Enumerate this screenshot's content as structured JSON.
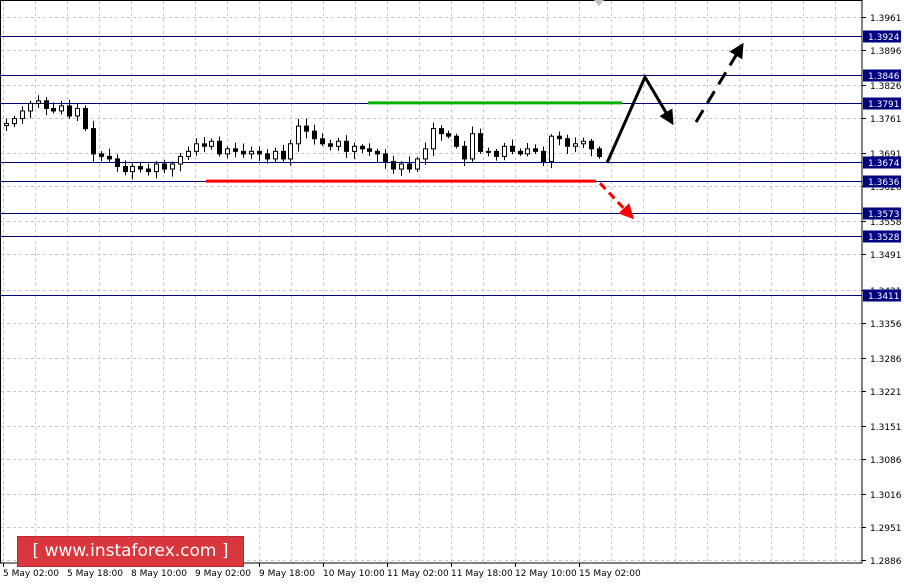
{
  "chart_data": {
    "type": "candlestick",
    "title": "",
    "y_range": [
      1.2886,
      1.3961
    ],
    "y_ticks": [
      "1.3961",
      "1.3896",
      "1.3826",
      "1.3761",
      "1.3691",
      "1.3626",
      "1.3558",
      "1.3491",
      "1.3421",
      "1.3356",
      "1.3286",
      "1.3221",
      "1.3151",
      "1.3086",
      "1.3016",
      "1.2951",
      "1.2886"
    ],
    "x_labels": [
      "5 May 02:00",
      "5 May 18:00",
      "8 May 10:00",
      "9 May 02:00",
      "9 May 18:00",
      "10 May 10:00",
      "11 May 02:00",
      "11 May 18:00",
      "12 May 10:00",
      "15 May 02:00"
    ],
    "levels": [
      {
        "label": "1.3924",
        "value": 1.3924
      },
      {
        "label": "1.3846",
        "value": 1.3846
      },
      {
        "label": "1.3791",
        "value": 1.3791
      },
      {
        "label": "1.3674",
        "value": 1.3674
      },
      {
        "label": "1.3636",
        "value": 1.3636
      },
      {
        "label": "1.3573",
        "value": 1.3573
      },
      {
        "label": "1.3528",
        "value": 1.3528
      },
      {
        "label": "1.3411",
        "value": 1.3411
      }
    ],
    "close_series": [
      1.375,
      1.376,
      1.3775,
      1.379,
      1.3795,
      1.378,
      1.3775,
      1.3785,
      1.3765,
      1.378,
      1.374,
      1.369,
      1.3685,
      1.368,
      1.3665,
      1.3655,
      1.3665,
      1.366,
      1.3655,
      1.367,
      1.366,
      1.367,
      1.3685,
      1.3695,
      1.371,
      1.3705,
      1.3715,
      1.369,
      1.37,
      1.3695,
      1.369,
      1.3695,
      1.369,
      1.368,
      1.3695,
      1.368,
      1.371,
      1.3745,
      1.3735,
      1.372,
      1.371,
      1.3705,
      1.3715,
      1.3695,
      1.3705,
      1.37,
      1.3695,
      1.369,
      1.3675,
      1.366,
      1.367,
      1.366,
      1.368,
      1.37,
      1.374,
      1.373,
      1.3725,
      1.3705,
      1.368,
      1.373,
      1.3695,
      1.3695,
      1.3685,
      1.3705,
      1.3695,
      1.369,
      1.37,
      1.3695,
      1.3675,
      1.3725,
      1.372,
      1.3705,
      1.371,
      1.3715,
      1.37,
      1.3685
    ],
    "support_line": {
      "value": 1.3636,
      "color": "#ff0000"
    },
    "resistance_line": {
      "value": 1.3791,
      "color": "#00b000"
    },
    "colors": {
      "level_line": "#000080",
      "label_bg": "#000080",
      "candles": "#000000",
      "grid": "#c8c8c8",
      "forecast_up": "#000000",
      "forecast_down": "#ff0000"
    }
  },
  "watermark": {
    "text": "[ www.instaforex.com ]",
    "color": "#d9363e"
  }
}
